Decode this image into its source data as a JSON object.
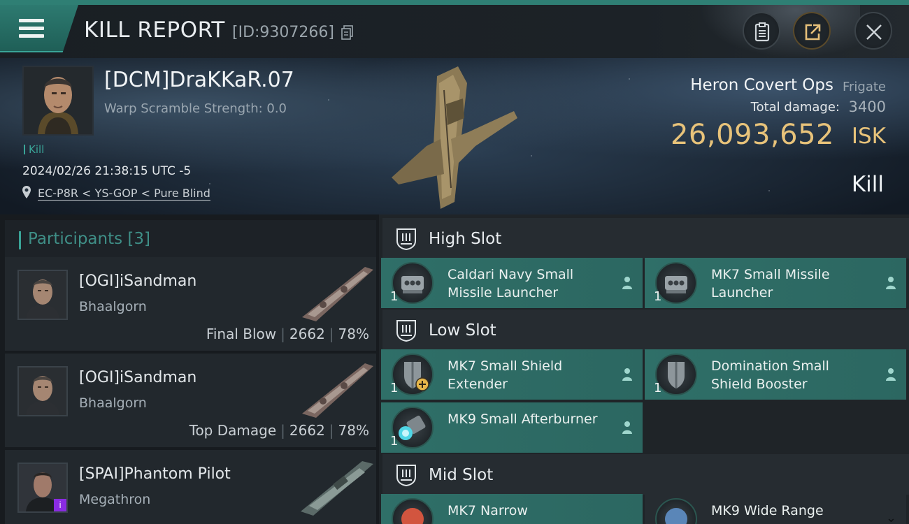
{
  "header": {
    "title": "KILL REPORT",
    "id": "[ID:9307266]"
  },
  "victim": {
    "name": "[DCM]DraKKaR.07",
    "warp": "Warp Scramble Strength: 0.0",
    "kill_tag": "Kill",
    "datetime": "2024/02/26 21:38:15 UTC -5",
    "location": "EC-P8R < YS-GOP < Pure Blind",
    "ship_name": "Heron Covert Ops",
    "ship_class": "Frigate",
    "damage_label": "Total damage:",
    "damage_value": "3400",
    "isk_value": "26,093,652",
    "isk_unit": "ISK",
    "result": "Kill"
  },
  "participants": {
    "title": "Participants [3]",
    "items": [
      {
        "name": "[OGI]iSandman",
        "ship": "Bhaalgorn",
        "role": "Final Blow",
        "damage": "2662",
        "percent": "78%"
      },
      {
        "name": "[OGI]iSandman",
        "ship": "Bhaalgorn",
        "role": "Top Damage",
        "damage": "2662",
        "percent": "78%"
      },
      {
        "name": "[SPAI]Phantom Pilot",
        "ship": "Megathron",
        "badge": "i"
      }
    ]
  },
  "fitting": {
    "high_slot": {
      "title": "High Slot",
      "modules": [
        {
          "name": "Caldari Navy Small Missile Launcher",
          "qty": "1"
        },
        {
          "name": "MK7 Small Missile Launcher",
          "qty": "1"
        }
      ]
    },
    "low_slot": {
      "title": "Low Slot",
      "modules": [
        {
          "name": "MK7 Small Shield Extender",
          "qty": "1"
        },
        {
          "name": "Domination Small Shield Booster",
          "qty": "1"
        },
        {
          "name": "MK9 Small Afterburner",
          "qty": "1"
        }
      ]
    },
    "mid_slot": {
      "title": "Mid Slot",
      "modules": [
        {
          "name": "MK7 Narrow"
        },
        {
          "name": "MK9 Wide Range"
        }
      ]
    }
  },
  "colors": {
    "accent": "#3aa497",
    "isk": "#e8c37a",
    "module_bg": "#2f6f68"
  }
}
